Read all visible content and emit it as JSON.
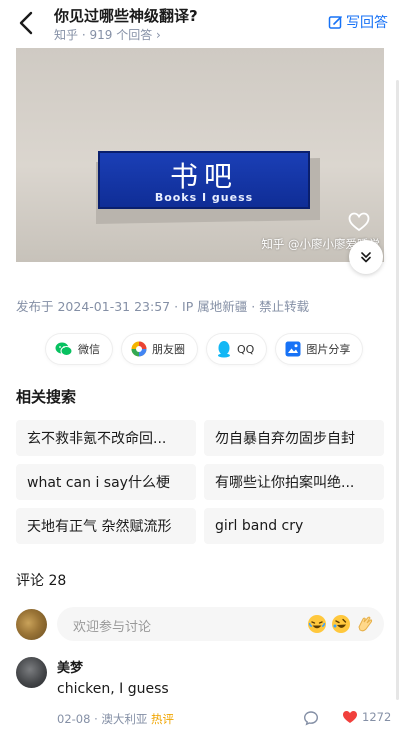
{
  "header": {
    "question_title": "你见过哪些神级翻译?",
    "source": "知乎",
    "answer_count": "919 个回答",
    "write_answer_label": "写回答"
  },
  "photo": {
    "sign_chinese": "书吧",
    "sign_english": "Books I guess",
    "watermark": "知乎 @小廖小廖爱睡觉"
  },
  "post_meta": "发布于 2024-01-31 23:57 · IP 属地新疆 · 禁止转载",
  "share": {
    "wechat": "微信",
    "moments": "朋友圈",
    "qq": "QQ",
    "image_share": "图片分享"
  },
  "related_search": {
    "title": "相关搜索",
    "items": [
      "玄不救非氪不改命回...",
      "勿自暴自弃勿固步自封",
      "what can i say什么梗",
      "有哪些让你拍案叫绝...",
      "天地有正气 杂然赋流形",
      "girl band cry"
    ]
  },
  "comments": {
    "header": "评论 28",
    "input_placeholder": "欢迎参与讨论",
    "items": [
      {
        "author": "美梦",
        "text": "chicken, I guess",
        "date": "02-08",
        "location": "澳大利亚",
        "badge": "热评",
        "likes": "1272"
      }
    ]
  },
  "colors": {
    "accent_blue": "#1772f6",
    "like_red": "#f1403c",
    "hot_badge": "#f0a500",
    "sign_blue": "#1b3fb6"
  }
}
